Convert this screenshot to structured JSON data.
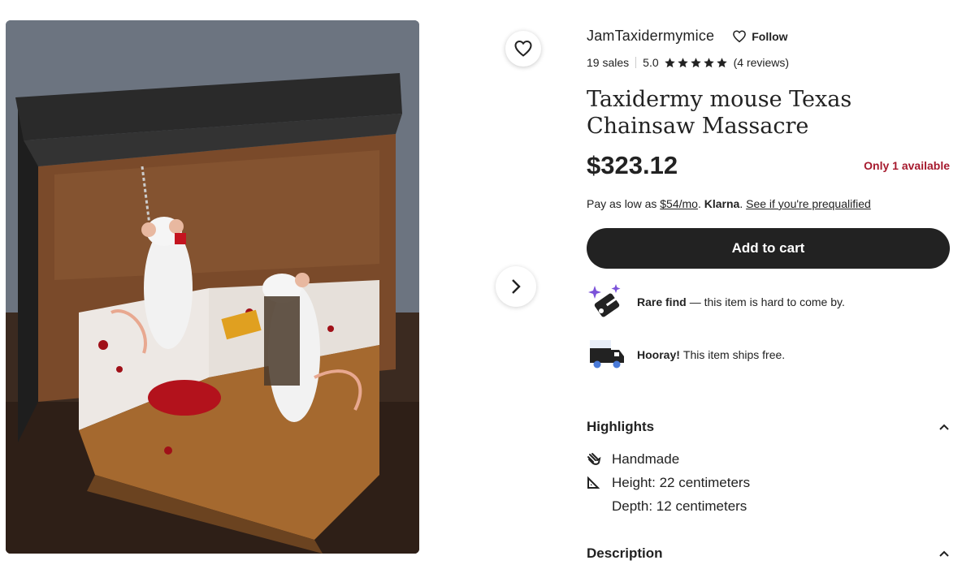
{
  "listing": {
    "image_alt": "Taxidermy mice diorama",
    "shop_name": "JamTaxidermymice",
    "follow_label": "Follow",
    "sales": "19 sales",
    "rating": "5.0",
    "stars": 5,
    "reviews": "(4 reviews)",
    "title": "Taxidermy mouse Texas Chainsaw Massacre",
    "price": "$323.12",
    "stock": "Only 1 available",
    "klarna": {
      "prefix": "Pay as low as",
      "amount": "$54/mo",
      "brand": "Klarna",
      "link": "See if you're prequalified"
    },
    "add_to_cart": "Add to cart",
    "perks": [
      {
        "bold": "Rare find",
        "text": "— this item is hard to come by.",
        "icon": "sparkle-tag-icon"
      },
      {
        "bold": "Hooray!",
        "text": "This item ships free.",
        "icon": "truck-icon"
      }
    ],
    "highlights": {
      "heading": "Highlights",
      "items": [
        {
          "text": "Handmade",
          "icon": "hand-icon"
        },
        {
          "text": "Height: 22 centimeters",
          "icon": "ruler-triangle-icon"
        },
        {
          "text": "Depth: 12 centimeters",
          "icon": ""
        }
      ]
    },
    "description": {
      "heading": "Description"
    }
  },
  "colors": {
    "accent_dark": "#222222",
    "stock_red": "#a61a2e",
    "star": "#222222",
    "icon_purple": "#7b52d9",
    "icon_blue": "#4a7bd9"
  }
}
